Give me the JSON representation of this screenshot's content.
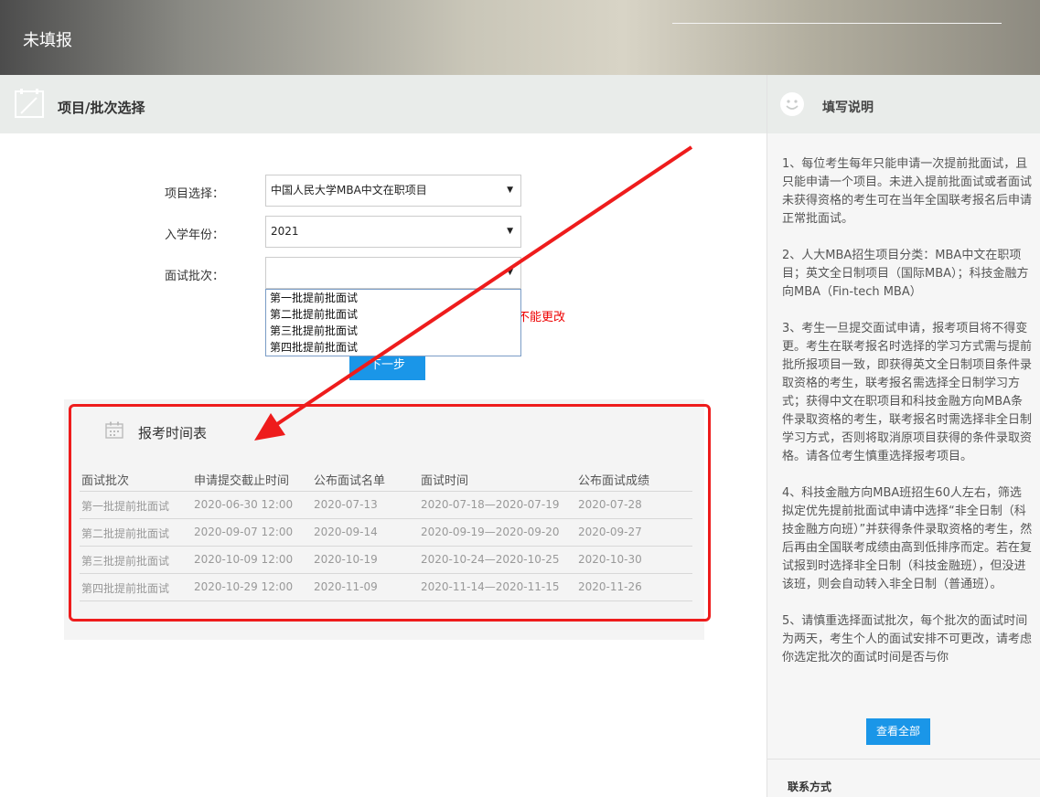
{
  "header": {
    "title": "未填报"
  },
  "section": {
    "title": "项目/批次选择"
  },
  "form": {
    "project_label": "项目选择：",
    "project_value": "中国人民大学MBA中文在职项目",
    "year_label": "入学年份：",
    "year_value": "2021",
    "batch_label": "面试批次：",
    "batch_value": "",
    "batch_options": [
      "第一批提前批面试",
      "第二批提前批面试",
      "第三批提前批面试",
      "第四批提前批面试"
    ],
    "warning_partial": "不能更改",
    "next_button": "下一步"
  },
  "schedule": {
    "title": "报考时间表",
    "headers": [
      "面试批次",
      "申请提交截止时间",
      "公布面试名单",
      "面试时间",
      "公布面试成绩"
    ],
    "rows": [
      [
        "第一批提前批面试",
        "2020-06-30 12:00",
        "2020-07-13",
        "2020-07-18—2020-07-19",
        "2020-07-28"
      ],
      [
        "第二批提前批面试",
        "2020-09-07 12:00",
        "2020-09-14",
        "2020-09-19—2020-09-20",
        "2020-09-27"
      ],
      [
        "第三批提前批面试",
        "2020-10-09 12:00",
        "2020-10-19",
        "2020-10-24—2020-10-25",
        "2020-10-30"
      ],
      [
        "第四批提前批面试",
        "2020-10-29 12:00",
        "2020-11-09",
        "2020-11-14—2020-11-15",
        "2020-11-26"
      ]
    ]
  },
  "sidebar": {
    "title": "填写说明",
    "notes": [
      "1、每位考生每年只能申请一次提前批面试，且只能申请一个项目。未进入提前批面试或者面试未获得资格的考生可在当年全国联考报名后申请正常批面试。",
      "2、人大MBA招生项目分类：MBA中文在职项目；英文全日制项目（国际MBA）；科技金融方向MBA（Fin-tech MBA）",
      "3、考生一旦提交面试申请，报考项目将不得变更。考生在联考报名时选择的学习方式需与提前批所报项目一致，即获得英文全日制项目条件录取资格的考生，联考报名需选择全日制学习方式；获得中文在职项目和科技金融方向MBA条件录取资格的考生，联考报名时需选择非全日制学习方式，否则将取消原项目获得的条件录取资格。请各位考生慎重选择报考项目。",
      "4、科技金融方向MBA班招生60人左右，筛选拟定优先提前批面试申请中选择“非全日制（科技金融方向班）”并获得条件录取资格的考生，然后再由全国联考成绩由高到低排序而定。若在复试报到时选择非全日制（科技金融班），但没进该班，则会自动转入非全日制（普通班）。",
      "5、请慎重选择面试批次，每个批次的面试时间为两天，考生个人的面试安排不可更改，请考虑你选定批次的面试时间是否与你"
    ],
    "view_all": "查看全部",
    "contact_title": "联系方式"
  },
  "colors": {
    "accent": "#1a96e8",
    "annotation_red": "#ee1c1c",
    "warning_red": "#ee0000"
  }
}
